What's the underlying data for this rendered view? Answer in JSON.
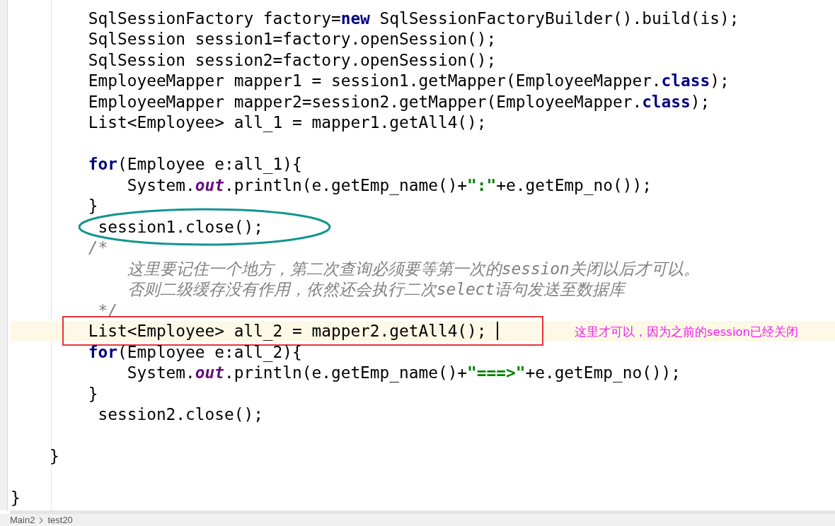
{
  "code_lines": [
    {
      "current": false,
      "circled": false,
      "boxed": false,
      "segments": [
        {
          "kind": "plain",
          "text": "        SqlSessionFactory factory="
        },
        {
          "kind": "keyword",
          "text": "new"
        },
        {
          "kind": "plain",
          "text": " SqlSessionFactoryBuilder().build(is);"
        }
      ]
    },
    {
      "current": false,
      "circled": false,
      "boxed": false,
      "segments": [
        {
          "kind": "plain",
          "text": "        SqlSession session1=factory.openSession();"
        }
      ]
    },
    {
      "current": false,
      "circled": false,
      "boxed": false,
      "segments": [
        {
          "kind": "plain",
          "text": "        SqlSession session2=factory.openSession();"
        }
      ]
    },
    {
      "current": false,
      "circled": false,
      "boxed": false,
      "segments": [
        {
          "kind": "plain",
          "text": "        EmployeeMapper mapper1 = session1.getMapper(EmployeeMapper."
        },
        {
          "kind": "keyword",
          "text": "class"
        },
        {
          "kind": "plain",
          "text": ");"
        }
      ]
    },
    {
      "current": false,
      "circled": false,
      "boxed": false,
      "segments": [
        {
          "kind": "plain",
          "text": "        EmployeeMapper mapper2=session2.getMapper(EmployeeMapper."
        },
        {
          "kind": "keyword",
          "text": "class"
        },
        {
          "kind": "plain",
          "text": ");"
        }
      ]
    },
    {
      "current": false,
      "circled": false,
      "boxed": false,
      "segments": [
        {
          "kind": "plain",
          "text": "        List<Employee> all_1 = mapper1.getAll4();"
        }
      ]
    },
    {
      "current": false,
      "circled": false,
      "boxed": false
    },
    {
      "current": false,
      "circled": false,
      "boxed": false,
      "segments": [
        {
          "kind": "keyword",
          "text": "        for"
        },
        {
          "kind": "plain",
          "text": "(Employee e:all_1){"
        }
      ]
    },
    {
      "current": false,
      "circled": false,
      "boxed": false,
      "segments": [
        {
          "kind": "plain",
          "text": "            System."
        },
        {
          "kind": "static",
          "text": "out"
        },
        {
          "kind": "plain",
          "text": ".println(e.getEmp_name()+"
        },
        {
          "kind": "string",
          "text": "\":\""
        },
        {
          "kind": "plain",
          "text": "+e.getEmp_no());"
        }
      ]
    },
    {
      "current": false,
      "circled": false,
      "boxed": false,
      "segments": [
        {
          "kind": "plain",
          "text": "        }"
        }
      ]
    },
    {
      "current": false,
      "circled": true,
      "boxed": false,
      "segments": [
        {
          "kind": "plain",
          "text": "         session1.close();"
        }
      ]
    },
    {
      "current": false,
      "circled": false,
      "boxed": false,
      "segments": [
        {
          "kind": "comment",
          "text": "        /*"
        }
      ]
    },
    {
      "current": false,
      "circled": false,
      "boxed": false,
      "segments": [
        {
          "kind": "comment",
          "text": "            这里要记住一个地方，第二次查询必须要等第一次的session关闭以后才可以。"
        }
      ]
    },
    {
      "current": false,
      "circled": false,
      "boxed": false,
      "segments": [
        {
          "kind": "comment",
          "text": "            否则二级缓存没有作用，依然还会执行二次select语句发送至数据库"
        }
      ]
    },
    {
      "current": false,
      "circled": false,
      "boxed": false,
      "segments": [
        {
          "kind": "comment",
          "text": "         */"
        }
      ]
    },
    {
      "current": true,
      "circled": false,
      "boxed": true,
      "note": "这里才可以，因为之前的session已经关闭",
      "segments": [
        {
          "kind": "plain",
          "text": "        List<Employee> all_2 = mapper2.getAll4();"
        }
      ]
    },
    {
      "current": false,
      "circled": false,
      "boxed": false,
      "segments": [
        {
          "kind": "keyword",
          "text": "        for"
        },
        {
          "kind": "plain",
          "text": "(Employee e:all_2){"
        }
      ]
    },
    {
      "current": false,
      "circled": false,
      "boxed": false,
      "segments": [
        {
          "kind": "plain",
          "text": "            System."
        },
        {
          "kind": "static",
          "text": "out"
        },
        {
          "kind": "plain",
          "text": ".println(e.getEmp_name()+"
        },
        {
          "kind": "string",
          "text": "\"===>\""
        },
        {
          "kind": "plain",
          "text": "+e.getEmp_no());"
        }
      ]
    },
    {
      "current": false,
      "circled": false,
      "boxed": false,
      "segments": [
        {
          "kind": "plain",
          "text": "        }"
        }
      ]
    },
    {
      "current": false,
      "circled": false,
      "boxed": false,
      "segments": [
        {
          "kind": "plain",
          "text": "         session2.close();"
        }
      ]
    },
    {
      "current": false,
      "circled": false,
      "boxed": false
    },
    {
      "current": false,
      "circled": false,
      "boxed": false,
      "segments": [
        {
          "kind": "plain",
          "text": "    }"
        }
      ]
    },
    {
      "current": false,
      "circled": false,
      "boxed": false
    },
    {
      "current": false,
      "circled": false,
      "boxed": false,
      "segments": [
        {
          "kind": "plain",
          "text": "}"
        }
      ]
    }
  ],
  "breadcrumb": [
    "Main2",
    "test20"
  ]
}
